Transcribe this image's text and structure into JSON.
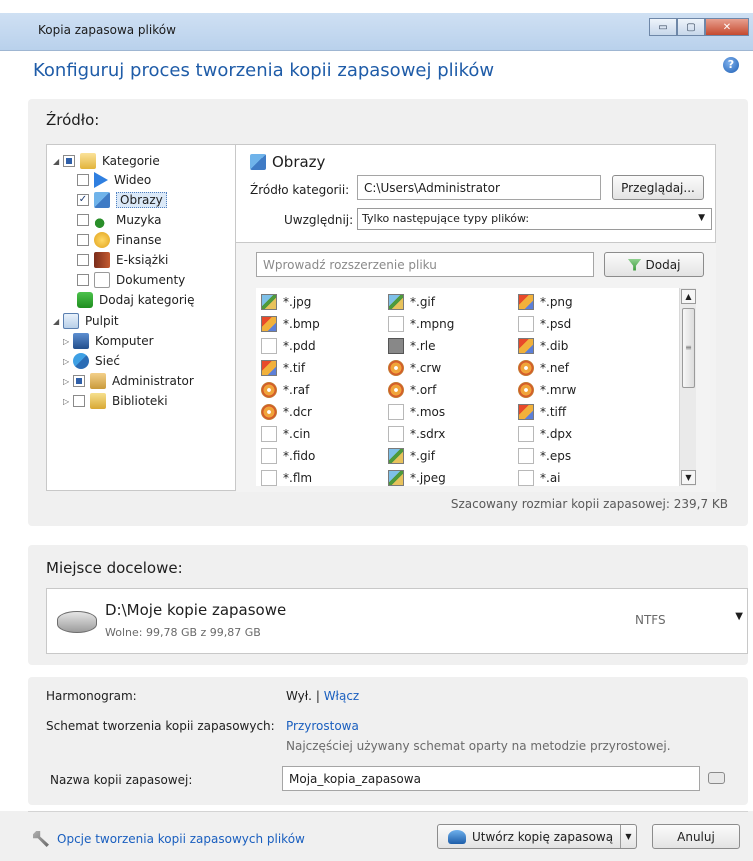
{
  "window": {
    "title": "Kopia zapasowa plików",
    "buttons": {
      "minimize": "▭",
      "maximize": "▢",
      "close": "✕"
    }
  },
  "heading": "Konfiguruj proces tworzenia kopii zapasowej plików",
  "help_label": "?",
  "source": {
    "label": "Źródło:",
    "tree": [
      {
        "label": "Kategorie",
        "icon": "folder-icon",
        "check": "partial",
        "expander": "◢"
      },
      {
        "label": "Wideo",
        "icon": "video-icon",
        "check": "unchecked"
      },
      {
        "label": "Obrazy",
        "icon": "pictures-icon",
        "check": "checked",
        "selected": true
      },
      {
        "label": "Muzyka",
        "icon": "music-icon",
        "check": "unchecked"
      },
      {
        "label": "Finanse",
        "icon": "finance-icon",
        "check": "unchecked"
      },
      {
        "label": "E-książki",
        "icon": "ebook-icon",
        "check": "unchecked"
      },
      {
        "label": "Dokumenty",
        "icon": "documents-icon",
        "check": "unchecked"
      },
      {
        "label": "Dodaj kategorię",
        "icon": "add-icon"
      },
      {
        "label": "Pulpit",
        "icon": "home-icon",
        "expander": "◢"
      },
      {
        "label": "Komputer",
        "icon": "computer-icon",
        "expander": "▷"
      },
      {
        "label": "Sieć",
        "icon": "network-icon",
        "expander": "▷"
      },
      {
        "label": "Administrator",
        "icon": "user-folder-icon",
        "check": "partial",
        "expander": "▷"
      },
      {
        "label": "Biblioteki",
        "icon": "library-icon",
        "check": "unchecked",
        "expander": "▷"
      }
    ],
    "category_title": "Obrazy",
    "source_label": "Źródło kategorii:",
    "source_value": "C:\\Users\\Administrator",
    "browse_button": "Przeglądaj...",
    "include_label": "Uwzględnij:",
    "include_value": "Tylko następujące typy plików:",
    "ext_placeholder": "Wprowadź rozszerzenie pliku",
    "add_button": "Dodaj",
    "extensions": [
      [
        "*.jpg",
        "*.gif",
        "*.png"
      ],
      [
        "*.bmp",
        "*.mpng",
        "*.psd"
      ],
      [
        "*.pdd",
        "*.rle",
        "*.dib"
      ],
      [
        "*.tif",
        "*.crw",
        "*.nef"
      ],
      [
        "*.raf",
        "*.orf",
        "*.mrw"
      ],
      [
        "*.dcr",
        "*.mos",
        "*.tiff"
      ],
      [
        "*.cin",
        "*.sdrx",
        "*.dpx"
      ],
      [
        "*.fido",
        "*.gif",
        "*.eps"
      ],
      [
        "*.flm",
        "*.jpeg",
        "*.ai"
      ]
    ],
    "estimated_size": "Szacowany rozmiar kopii zapasowej: 239,7 KB"
  },
  "destination": {
    "label": "Miejsce docelowe:",
    "path": "D:\\Moje kopie zapasowe",
    "free": "Wolne: 99,78 GB z 99,87 GB",
    "filesystem": "NTFS"
  },
  "options": {
    "schedule_label": "Harmonogram:",
    "schedule_off": "Wył.",
    "schedule_separator": "|",
    "schedule_on_link": "Włącz",
    "scheme_label": "Schemat tworzenia kopii zapasowych:",
    "scheme_link": "Przyrostowa",
    "scheme_desc": "Najczęściej używany schemat oparty na metodzie przyrostowej.",
    "name_label": "Nazwa kopii zapasowej:",
    "name_value": "Moja_kopia_zapasowa"
  },
  "footer": {
    "options_link": "Opcje tworzenia kopii zapasowych plików",
    "create_button": "Utwórz kopię zapasową",
    "cancel_button": "Anuluj"
  }
}
